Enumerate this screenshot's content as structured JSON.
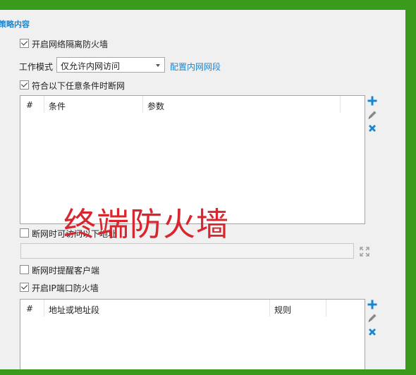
{
  "section_title": "策略内容",
  "enable_network_isolation": {
    "label": "开启网络隔离防火墙",
    "checked": true
  },
  "work_mode": {
    "label": "工作模式",
    "selected": "仅允许内网访问",
    "config_link": "配置内网网段"
  },
  "disconnect_conditions": {
    "label": "符合以下任意条件时断网",
    "checked": true
  },
  "conditions_table": {
    "columns": [
      "#",
      "条件",
      "参数"
    ]
  },
  "allow_access_when_disconnected": {
    "label": "断网时可访问以下地址",
    "checked": false
  },
  "notify_client": {
    "label": "断网时提醒客户端",
    "checked": false
  },
  "enable_ip_port_firewall": {
    "label": "开启IP端口防火墙",
    "checked": true
  },
  "ip_table": {
    "columns": [
      "#",
      "地址或地址段",
      "规则"
    ]
  },
  "overlay_caption": "终端防火墙",
  "colors": {
    "accent": "#1a86d0",
    "border": "#3a9a1c",
    "add": "#1a86d0",
    "remove": "#1a86d0",
    "overlay": "#d8262f"
  },
  "icons": {
    "add": "plus-icon",
    "edit": "pencil-icon",
    "remove": "x-icon",
    "expand": "expand-icon"
  }
}
